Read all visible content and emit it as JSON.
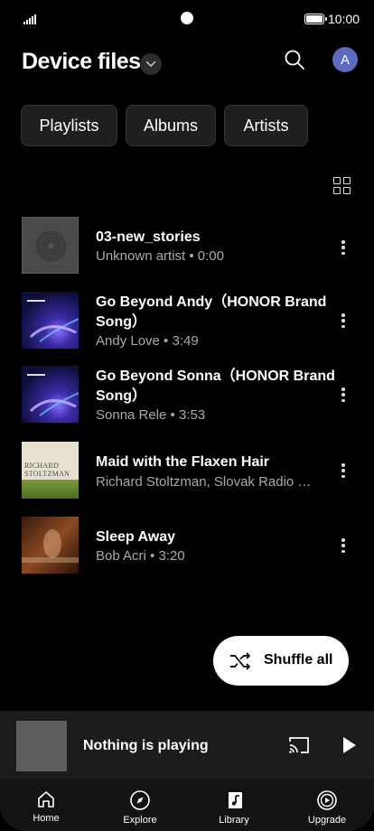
{
  "status_bar": {
    "time": "10:00"
  },
  "header": {
    "title": "Device files",
    "avatar_letter": "A"
  },
  "chips": [
    {
      "label": "Playlists"
    },
    {
      "label": "Albums"
    },
    {
      "label": "Artists"
    }
  ],
  "songs": [
    {
      "title": "03-new_stories",
      "subtitle": "Unknown artist • 0:00",
      "art": "vinyl-placeholder"
    },
    {
      "title": "Go Beyond Andy（HONOR Brand Song）",
      "subtitle": "Andy Love • 3:49",
      "art": "go-beyond-blue"
    },
    {
      "title": "Go Beyond Sonna（HONOR Brand Song）",
      "subtitle": "Sonna Rele • 3:53",
      "art": "go-beyond-blue"
    },
    {
      "title": "Maid with the Flaxen Hair",
      "subtitle": "Richard Stoltzman, Slovak Radio …",
      "art": "richard-stoltzman-cover",
      "art_text": "RICHARD STOLTZMAN"
    },
    {
      "title": "Sleep Away",
      "subtitle": "Bob Acri • 3:20",
      "art": "piano-sepia"
    }
  ],
  "shuffle": {
    "label": "Shuffle all"
  },
  "player": {
    "label": "Nothing is playing"
  },
  "nav": [
    {
      "label": "Home",
      "icon": "home-icon"
    },
    {
      "label": "Explore",
      "icon": "compass-icon"
    },
    {
      "label": "Library",
      "icon": "library-icon"
    },
    {
      "label": "Upgrade",
      "icon": "upgrade-icon"
    }
  ],
  "colors": {
    "background": "#000000",
    "avatar": "#5c6bc0",
    "chip": "#1f1f1f",
    "subtitle": "#a9a9a9"
  }
}
